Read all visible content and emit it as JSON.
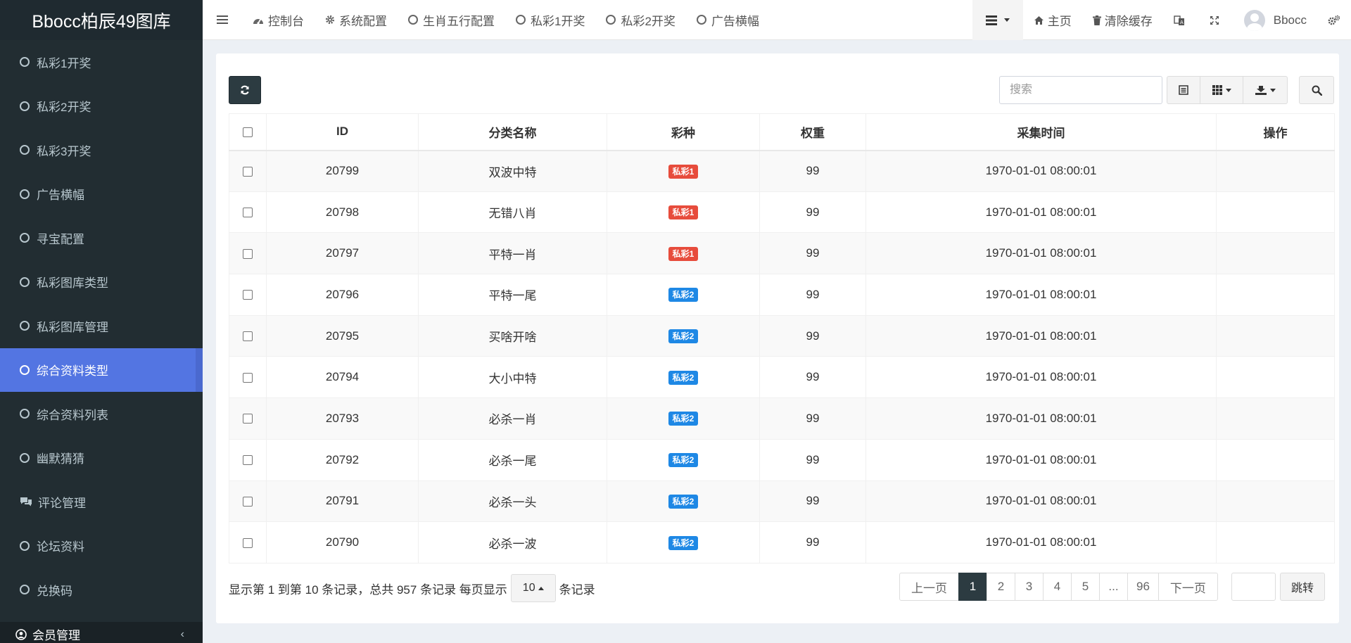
{
  "app": {
    "logo_text": "Bbocc柏辰49图库"
  },
  "sidebar": {
    "items": [
      {
        "label": "私彩1开奖",
        "icon": "circle-icon"
      },
      {
        "label": "私彩2开奖",
        "icon": "circle-icon"
      },
      {
        "label": "私彩3开奖",
        "icon": "circle-icon"
      },
      {
        "label": "广告横幅",
        "icon": "circle-icon"
      },
      {
        "label": "寻宝配置",
        "icon": "circle-icon"
      },
      {
        "label": "私彩图库类型",
        "icon": "circle-icon"
      },
      {
        "label": "私彩图库管理",
        "icon": "circle-icon"
      },
      {
        "label": "综合资料类型",
        "icon": "circle-icon",
        "active": true
      },
      {
        "label": "综合资料列表",
        "icon": "circle-icon"
      },
      {
        "label": "幽默猜猜",
        "icon": "circle-icon"
      },
      {
        "label": "评论管理",
        "icon": "comments-icon"
      },
      {
        "label": "论坛资料",
        "icon": "circle-icon"
      },
      {
        "label": "兑换码",
        "icon": "circle-icon"
      }
    ],
    "group": {
      "label": "会员管理",
      "icon": "user-circle-icon"
    }
  },
  "topnav": {
    "tabs": [
      {
        "label": "控制台",
        "icon": "dashboard-icon"
      },
      {
        "label": "系统配置",
        "icon": "gear-icon"
      },
      {
        "label": "生肖五行配置",
        "icon": "circle-icon"
      },
      {
        "label": "私彩1开奖",
        "icon": "circle-icon"
      },
      {
        "label": "私彩2开奖",
        "icon": "circle-icon"
      },
      {
        "label": "广告横幅",
        "icon": "circle-icon"
      }
    ],
    "home_label": "主页",
    "clear_cache_label": "清除缓存",
    "username": "Bbocc"
  },
  "toolbar": {
    "search_placeholder": "搜索"
  },
  "table": {
    "columns": [
      "ID",
      "分类名称",
      "彩种",
      "权重",
      "采集时间",
      "操作"
    ],
    "rows": [
      {
        "id": "20799",
        "name": "双波中特",
        "type": "私彩1",
        "type_color": "#e74c3c",
        "weight": "99",
        "time": "1970-01-01 08:00:01"
      },
      {
        "id": "20798",
        "name": "无错八肖",
        "type": "私彩1",
        "type_color": "#e74c3c",
        "weight": "99",
        "time": "1970-01-01 08:00:01"
      },
      {
        "id": "20797",
        "name": "平特一肖",
        "type": "私彩1",
        "type_color": "#e74c3c",
        "weight": "99",
        "time": "1970-01-01 08:00:01"
      },
      {
        "id": "20796",
        "name": "平特一尾",
        "type": "私彩2",
        "type_color": "#1e88e5",
        "weight": "99",
        "time": "1970-01-01 08:00:01"
      },
      {
        "id": "20795",
        "name": "买啥开啥",
        "type": "私彩2",
        "type_color": "#1e88e5",
        "weight": "99",
        "time": "1970-01-01 08:00:01"
      },
      {
        "id": "20794",
        "name": "大小中特",
        "type": "私彩2",
        "type_color": "#1e88e5",
        "weight": "99",
        "time": "1970-01-01 08:00:01"
      },
      {
        "id": "20793",
        "name": "必杀一肖",
        "type": "私彩2",
        "type_color": "#1e88e5",
        "weight": "99",
        "time": "1970-01-01 08:00:01"
      },
      {
        "id": "20792",
        "name": "必杀一尾",
        "type": "私彩2",
        "type_color": "#1e88e5",
        "weight": "99",
        "time": "1970-01-01 08:00:01"
      },
      {
        "id": "20791",
        "name": "必杀一头",
        "type": "私彩2",
        "type_color": "#1e88e5",
        "weight": "99",
        "time": "1970-01-01 08:00:01"
      },
      {
        "id": "20790",
        "name": "必杀一波",
        "type": "私彩2",
        "type_color": "#1e88e5",
        "weight": "99",
        "time": "1970-01-01 08:00:01"
      }
    ]
  },
  "pager": {
    "info_text": "显示第 1 到第 10 条记录，总共 957 条记录 每页显示",
    "page_size": "10",
    "suffix_text": "条记录",
    "prev_label": "上一页",
    "pages": [
      "1",
      "2",
      "3",
      "4",
      "5",
      "...",
      "96"
    ],
    "current_page": "1",
    "next_label": "下一页",
    "jump_label": "跳转"
  }
}
